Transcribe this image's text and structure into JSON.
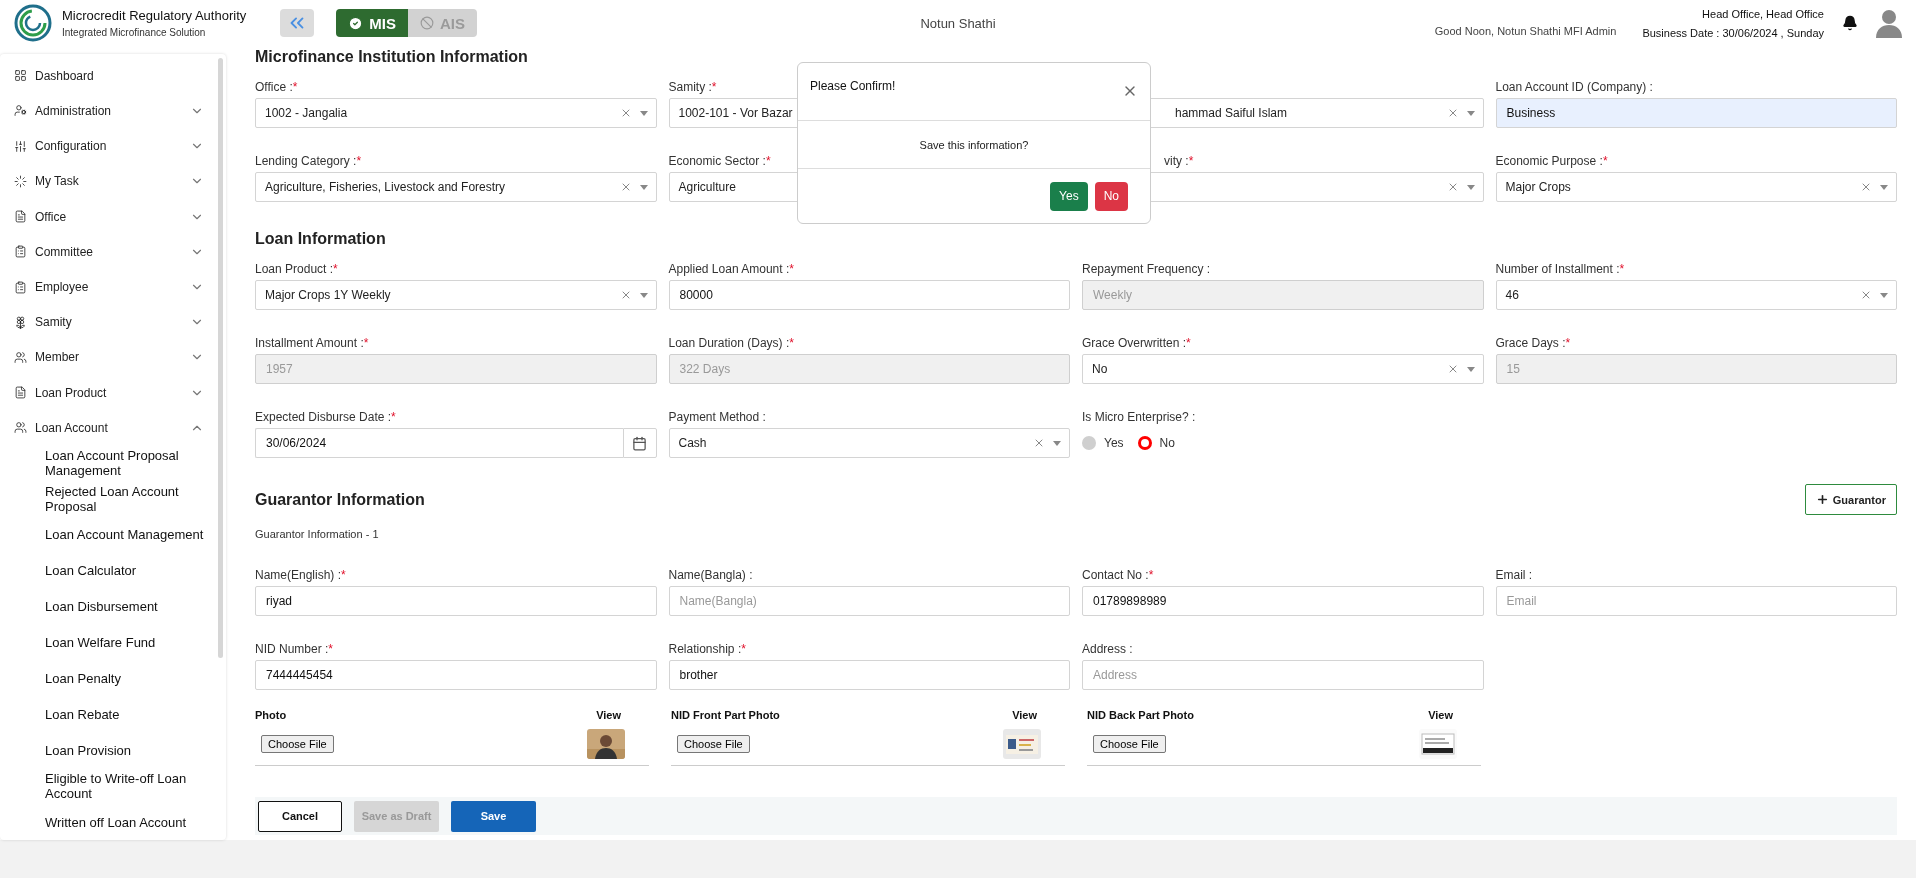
{
  "header": {
    "org_title": "Microcredit Regulatory Authority",
    "org_subtitle": "Integrated Microfinance Solution",
    "modules": [
      {
        "label": "MIS",
        "selected": true
      },
      {
        "label": "AIS",
        "selected": false
      }
    ],
    "app_name": "Notun Shathi",
    "greeting": "Good Noon, Notun Shathi MFI Admin",
    "office": "Head Office, Head Office",
    "business_date": "Business Date : 30/06/2024 , Sunday"
  },
  "sidebar": {
    "items": [
      {
        "label": "Dashboard"
      },
      {
        "label": "Administration",
        "expanded": false
      },
      {
        "label": "Configuration",
        "expanded": false
      },
      {
        "label": "My Task",
        "expanded": false
      },
      {
        "label": "Office",
        "expanded": false
      },
      {
        "label": "Committee",
        "expanded": false
      },
      {
        "label": "Employee",
        "expanded": false
      },
      {
        "label": "Samity",
        "expanded": false
      },
      {
        "label": "Member",
        "expanded": false
      },
      {
        "label": "Loan Product",
        "expanded": false
      },
      {
        "label": "Loan Account",
        "expanded": true,
        "children": [
          {
            "label": "Loan Account Proposal Management"
          },
          {
            "label": "Rejected Loan Account Proposal"
          },
          {
            "label": "Loan Account Management"
          },
          {
            "label": "Loan Calculator"
          },
          {
            "label": "Loan Disbursement"
          },
          {
            "label": "Loan Welfare Fund"
          },
          {
            "label": "Loan Penalty"
          },
          {
            "label": "Loan Rebate"
          },
          {
            "label": "Loan Provision"
          },
          {
            "label": "Eligible to Write-off Loan Account"
          },
          {
            "label": "Written off Loan Account"
          }
        ]
      }
    ]
  },
  "required_mark": "*",
  "sections": [
    {
      "title": "Microfinance Institution Information",
      "fields": [
        {
          "kind": "select",
          "label": "Office :",
          "required": true,
          "value": "1002 - Jangalia"
        },
        {
          "kind": "select",
          "label": "Samity :",
          "required": true,
          "value": "1002-101 - Vor Bazar"
        },
        {
          "kind": "select",
          "value": "hammad Saiful Islam"
        },
        {
          "kind": "input",
          "label": "Loan Account ID (Company) :",
          "required": false,
          "value": "Business",
          "disabled": false,
          "autofilled": true
        },
        {
          "kind": "select",
          "label": "Lending Category :",
          "required": true,
          "value": "Agriculture, Fisheries, Livestock and Forestry"
        },
        {
          "kind": "select",
          "label": "Economic Sector :",
          "required": true,
          "value": "Agriculture"
        },
        {
          "kind": "select",
          "label": "vity :",
          "required": true
        },
        {
          "kind": "select",
          "label": "Economic Purpose :",
          "required": true,
          "value": "Major Crops"
        }
      ]
    },
    {
      "title": "Loan Information",
      "fields": [
        {
          "kind": "select",
          "label": "Loan Product :",
          "required": true,
          "value": "Major Crops 1Y Weekly"
        },
        {
          "kind": "input",
          "label": "Applied Loan Amount :",
          "required": true,
          "value": "80000",
          "disabled": false
        },
        {
          "kind": "input",
          "label": "Repayment Frequency :",
          "required": false,
          "value": "Weekly",
          "disabled": true
        },
        {
          "kind": "select",
          "label": "Number of Installment :",
          "required": true,
          "value": "46"
        },
        {
          "kind": "input",
          "label": "Installment Amount :",
          "required": true,
          "value": "1957",
          "disabled": true
        },
        {
          "kind": "input",
          "label": "Loan Duration (Days) :",
          "required": true,
          "value": "322 Days",
          "disabled": true
        },
        {
          "kind": "select",
          "label": "Grace Overwritten :",
          "required": true,
          "value": "No"
        },
        {
          "kind": "input",
          "label": "Grace Days :",
          "required": true,
          "value": "15",
          "disabled": true
        },
        {
          "kind": "date",
          "label": "Expected Disburse Date :",
          "required": true,
          "value": "30/06/2024"
        },
        {
          "kind": "select",
          "label": "Payment Method :",
          "required": false,
          "value": "Cash"
        },
        {
          "kind": "radio",
          "label": "Is Micro Enterprise? :",
          "required": false,
          "options": [
            {
              "label": "Yes",
              "selected": false
            },
            {
              "label": "No",
              "selected": true
            }
          ]
        }
      ]
    }
  ],
  "guarantor": {
    "title": "Guarantor Information",
    "add_button": "Guarantor",
    "subtitle": "Guarantor Information - 1",
    "fields": [
      {
        "kind": "input",
        "label": "Name(English) :",
        "required": true,
        "value": "riyad",
        "disabled": false
      },
      {
        "kind": "input",
        "label": "Name(Bangla) :",
        "required": false,
        "placeholder": "Name(Bangla)",
        "disabled": false
      },
      {
        "kind": "input",
        "label": "Contact No :",
        "required": true,
        "value": "01789898989",
        "disabled": false
      },
      {
        "kind": "input",
        "label": "Email :",
        "required": false,
        "placeholder": "Email",
        "disabled": false
      },
      {
        "kind": "input",
        "label": "NID Number :",
        "required": true,
        "value": "7444445454",
        "disabled": false
      },
      {
        "kind": "input",
        "label": "Relationship :",
        "required": true,
        "value": "brother",
        "disabled": false
      },
      {
        "kind": "input",
        "label": "Address :",
        "required": false,
        "placeholder": "Address",
        "disabled": false
      }
    ],
    "uploads": [
      {
        "label": "Photo",
        "view": "View",
        "button": "Choose File"
      },
      {
        "label": "NID Front Part Photo",
        "view": "View",
        "button": "Choose File"
      },
      {
        "label": "NID Back Part Photo",
        "view": "View",
        "button": "Choose File"
      }
    ]
  },
  "actions": [
    {
      "label": "Cancel",
      "kind": "outline"
    },
    {
      "label": "Save as Draft",
      "kind": "disabled"
    },
    {
      "label": "Save",
      "kind": "primary"
    }
  ],
  "dialog": {
    "title": "Please Confirm!",
    "message": "Save this information?",
    "buttons": [
      {
        "label": "Yes",
        "kind": "confirm"
      },
      {
        "label": "No",
        "kind": "cancel"
      }
    ]
  }
}
